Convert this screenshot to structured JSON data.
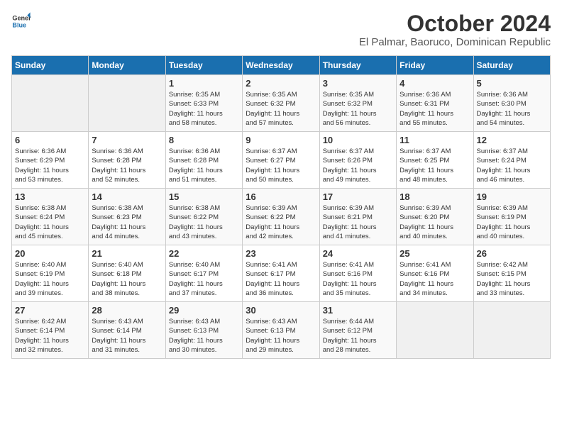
{
  "logo": {
    "line1": "General",
    "line2": "Blue"
  },
  "title": "October 2024",
  "subtitle": "El Palmar, Baoruco, Dominican Republic",
  "days_of_week": [
    "Sunday",
    "Monday",
    "Tuesday",
    "Wednesday",
    "Thursday",
    "Friday",
    "Saturday"
  ],
  "weeks": [
    [
      {
        "day": "",
        "info": ""
      },
      {
        "day": "",
        "info": ""
      },
      {
        "day": "1",
        "info": "Sunrise: 6:35 AM\nSunset: 6:33 PM\nDaylight: 11 hours\nand 58 minutes."
      },
      {
        "day": "2",
        "info": "Sunrise: 6:35 AM\nSunset: 6:32 PM\nDaylight: 11 hours\nand 57 minutes."
      },
      {
        "day": "3",
        "info": "Sunrise: 6:35 AM\nSunset: 6:32 PM\nDaylight: 11 hours\nand 56 minutes."
      },
      {
        "day": "4",
        "info": "Sunrise: 6:36 AM\nSunset: 6:31 PM\nDaylight: 11 hours\nand 55 minutes."
      },
      {
        "day": "5",
        "info": "Sunrise: 6:36 AM\nSunset: 6:30 PM\nDaylight: 11 hours\nand 54 minutes."
      }
    ],
    [
      {
        "day": "6",
        "info": "Sunrise: 6:36 AM\nSunset: 6:29 PM\nDaylight: 11 hours\nand 53 minutes."
      },
      {
        "day": "7",
        "info": "Sunrise: 6:36 AM\nSunset: 6:28 PM\nDaylight: 11 hours\nand 52 minutes."
      },
      {
        "day": "8",
        "info": "Sunrise: 6:36 AM\nSunset: 6:28 PM\nDaylight: 11 hours\nand 51 minutes."
      },
      {
        "day": "9",
        "info": "Sunrise: 6:37 AM\nSunset: 6:27 PM\nDaylight: 11 hours\nand 50 minutes."
      },
      {
        "day": "10",
        "info": "Sunrise: 6:37 AM\nSunset: 6:26 PM\nDaylight: 11 hours\nand 49 minutes."
      },
      {
        "day": "11",
        "info": "Sunrise: 6:37 AM\nSunset: 6:25 PM\nDaylight: 11 hours\nand 48 minutes."
      },
      {
        "day": "12",
        "info": "Sunrise: 6:37 AM\nSunset: 6:24 PM\nDaylight: 11 hours\nand 46 minutes."
      }
    ],
    [
      {
        "day": "13",
        "info": "Sunrise: 6:38 AM\nSunset: 6:24 PM\nDaylight: 11 hours\nand 45 minutes."
      },
      {
        "day": "14",
        "info": "Sunrise: 6:38 AM\nSunset: 6:23 PM\nDaylight: 11 hours\nand 44 minutes."
      },
      {
        "day": "15",
        "info": "Sunrise: 6:38 AM\nSunset: 6:22 PM\nDaylight: 11 hours\nand 43 minutes."
      },
      {
        "day": "16",
        "info": "Sunrise: 6:39 AM\nSunset: 6:22 PM\nDaylight: 11 hours\nand 42 minutes."
      },
      {
        "day": "17",
        "info": "Sunrise: 6:39 AM\nSunset: 6:21 PM\nDaylight: 11 hours\nand 41 minutes."
      },
      {
        "day": "18",
        "info": "Sunrise: 6:39 AM\nSunset: 6:20 PM\nDaylight: 11 hours\nand 40 minutes."
      },
      {
        "day": "19",
        "info": "Sunrise: 6:39 AM\nSunset: 6:19 PM\nDaylight: 11 hours\nand 40 minutes."
      }
    ],
    [
      {
        "day": "20",
        "info": "Sunrise: 6:40 AM\nSunset: 6:19 PM\nDaylight: 11 hours\nand 39 minutes."
      },
      {
        "day": "21",
        "info": "Sunrise: 6:40 AM\nSunset: 6:18 PM\nDaylight: 11 hours\nand 38 minutes."
      },
      {
        "day": "22",
        "info": "Sunrise: 6:40 AM\nSunset: 6:17 PM\nDaylight: 11 hours\nand 37 minutes."
      },
      {
        "day": "23",
        "info": "Sunrise: 6:41 AM\nSunset: 6:17 PM\nDaylight: 11 hours\nand 36 minutes."
      },
      {
        "day": "24",
        "info": "Sunrise: 6:41 AM\nSunset: 6:16 PM\nDaylight: 11 hours\nand 35 minutes."
      },
      {
        "day": "25",
        "info": "Sunrise: 6:41 AM\nSunset: 6:16 PM\nDaylight: 11 hours\nand 34 minutes."
      },
      {
        "day": "26",
        "info": "Sunrise: 6:42 AM\nSunset: 6:15 PM\nDaylight: 11 hours\nand 33 minutes."
      }
    ],
    [
      {
        "day": "27",
        "info": "Sunrise: 6:42 AM\nSunset: 6:14 PM\nDaylight: 11 hours\nand 32 minutes."
      },
      {
        "day": "28",
        "info": "Sunrise: 6:43 AM\nSunset: 6:14 PM\nDaylight: 11 hours\nand 31 minutes."
      },
      {
        "day": "29",
        "info": "Sunrise: 6:43 AM\nSunset: 6:13 PM\nDaylight: 11 hours\nand 30 minutes."
      },
      {
        "day": "30",
        "info": "Sunrise: 6:43 AM\nSunset: 6:13 PM\nDaylight: 11 hours\nand 29 minutes."
      },
      {
        "day": "31",
        "info": "Sunrise: 6:44 AM\nSunset: 6:12 PM\nDaylight: 11 hours\nand 28 minutes."
      },
      {
        "day": "",
        "info": ""
      },
      {
        "day": "",
        "info": ""
      }
    ]
  ]
}
